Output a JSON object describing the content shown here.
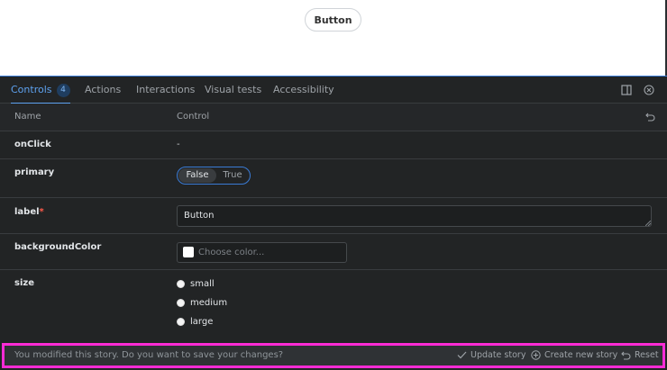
{
  "preview": {
    "button_label": "Button"
  },
  "tabs": [
    {
      "label": "Controls",
      "badge": "4"
    },
    {
      "label": "Actions"
    },
    {
      "label": "Interactions"
    },
    {
      "label": "Visual tests"
    },
    {
      "label": "Accessibility"
    }
  ],
  "table": {
    "name_header": "Name",
    "control_header": "Control",
    "rows": {
      "onClick": {
        "name": "onClick",
        "value": "-"
      },
      "primary": {
        "name": "primary",
        "options": [
          "False",
          "True"
        ],
        "selected": "False"
      },
      "label": {
        "name": "label",
        "required_marker": "*",
        "value": "Button"
      },
      "backgroundColor": {
        "name": "backgroundColor",
        "placeholder": "Choose color..."
      },
      "size": {
        "name": "size",
        "options": [
          "small",
          "medium",
          "large"
        ]
      }
    }
  },
  "savebar": {
    "message": "You modified this story. Do you want to save your changes?",
    "update_label": "Update story",
    "create_label": "Create new story",
    "reset_label": "Reset"
  },
  "colors": {
    "accent": "#5ea2f0",
    "highlight_border": "#ff2bd6",
    "panel_bg": "#222425"
  },
  "icons": [
    "panel-layout-icon",
    "close-circle-icon",
    "undo-icon",
    "checkmark-icon",
    "add-circle-icon",
    "reset-icon"
  ]
}
